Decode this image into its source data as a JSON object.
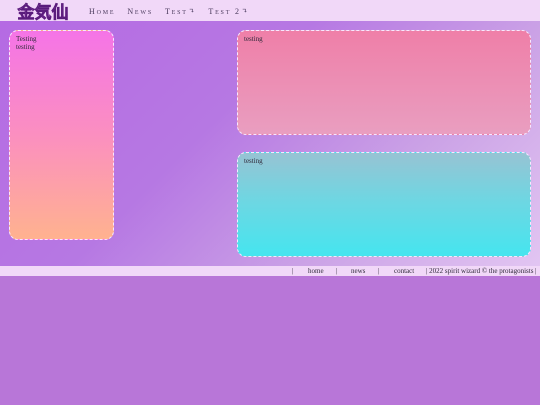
{
  "header": {
    "logo_text": "金気仙",
    "nav": [
      {
        "label": "Home",
        "has_dropdown": false
      },
      {
        "label": "News",
        "has_dropdown": false
      },
      {
        "label": "Test",
        "has_dropdown": true,
        "caret": "↴"
      },
      {
        "label": "Test 2",
        "has_dropdown": true,
        "caret": "↴"
      }
    ]
  },
  "content": {
    "left_box": {
      "title": "Testing",
      "text": "testing"
    },
    "top_box": {
      "text": "testing"
    },
    "bottom_box": {
      "text": "testing"
    }
  },
  "footer": {
    "separator": "|",
    "links": [
      "home",
      "news",
      "contact"
    ],
    "copyright": "| 2022 spirit wizard © the protagonists |"
  },
  "colors": {
    "background": "#b876d8",
    "header_bg": "#f1d8f8",
    "left_box_gradient": [
      "#f574e7",
      "#ffb28f"
    ],
    "top_box_gradient": [
      "#ef7fa8",
      "#e99ec0"
    ],
    "bottom_box_gradient": [
      "#97c3d3",
      "#45e5ef"
    ]
  }
}
